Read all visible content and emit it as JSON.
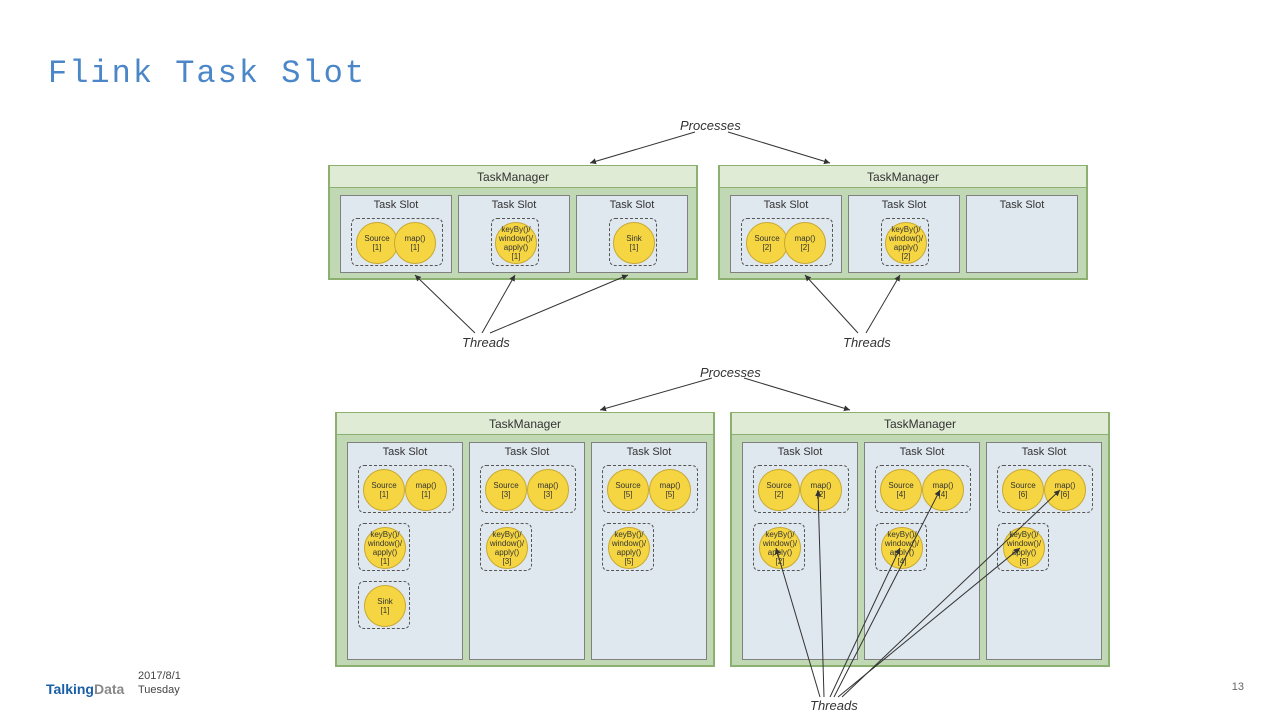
{
  "title": "Flink Task Slot",
  "labels": {
    "processes": "Processes",
    "threads": "Threads",
    "taskManager": "TaskManager",
    "taskSlot": "Task Slot"
  },
  "diagram1": {
    "tm1": {
      "slot1": {
        "src": "Source\n[1]",
        "map": "map()\n[1]"
      },
      "slot2": {
        "kb": "keyBy()/\nwindow()/\napply()\n[1]"
      },
      "slot3": {
        "sink": "Sink\n[1]"
      }
    },
    "tm2": {
      "slot1": {
        "src": "Source\n[2]",
        "map": "map()\n[2]"
      },
      "slot2": {
        "kb": "keyBy()/\nwindow()/\napply()\n[2]"
      },
      "slot3": {}
    }
  },
  "diagram2": {
    "tm1": {
      "slot1": {
        "src": "Source\n[1]",
        "map": "map()\n[1]",
        "kb": "keyBy()/\nwindow()/\napply()\n[1]",
        "sink": "Sink\n[1]"
      },
      "slot2": {
        "src": "Source\n[3]",
        "map": "map()\n[3]",
        "kb": "keyBy()/\nwindow()/\napply()\n[3]"
      },
      "slot3": {
        "src": "Source\n[5]",
        "map": "map()\n[5]",
        "kb": "keyBy()/\nwindow()/\napply()\n[5]"
      }
    },
    "tm2": {
      "slot1": {
        "src": "Source\n[2]",
        "map": "map()\n[2]",
        "kb": "keyBy()/\nwindow()/\napply()\n[2]"
      },
      "slot2": {
        "src": "Source\n[4]",
        "map": "map()\n[4]",
        "kb": "keyBy()/\nwindow()/\napply()\n[4]"
      },
      "slot3": {
        "src": "Source\n[6]",
        "map": "map()\n[6]",
        "kb": "keyBy()/\nwindow()/\napply()\n[6]"
      }
    }
  },
  "footer": {
    "date": "2017/8/1",
    "day": "Tuesday",
    "logo1": "Talking",
    "logo2": "Data",
    "page": "13"
  }
}
